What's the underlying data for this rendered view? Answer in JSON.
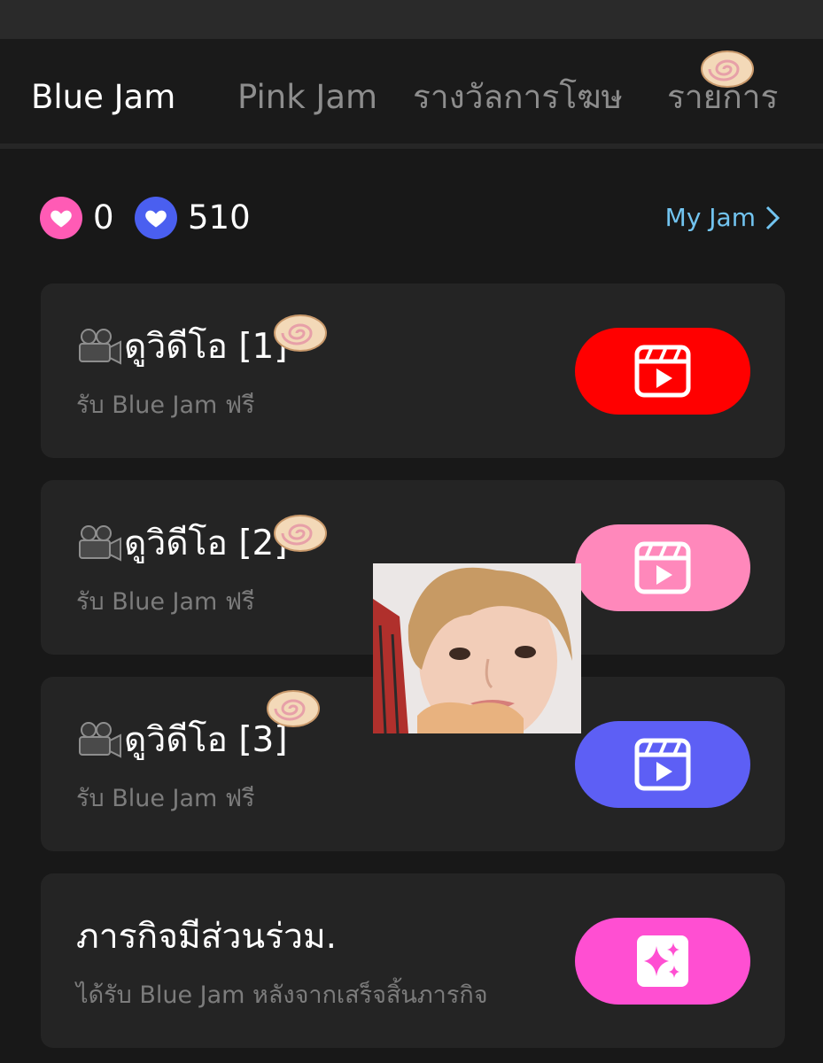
{
  "tabs": [
    {
      "label": "Blue Jam",
      "active": true
    },
    {
      "label": "Pink Jam",
      "active": false
    },
    {
      "label": "รางวัลการโฆษ",
      "active": false
    },
    {
      "label": "รายการ",
      "active": false
    }
  ],
  "balances": {
    "pink_count": "0",
    "blue_count": "510",
    "pink_color": "#ff5bb5",
    "blue_color": "#4a5ff0"
  },
  "my_jam_link": "My Jam",
  "cards": [
    {
      "title": "ดูวิดีโอ [1]",
      "subtitle": "รับ Blue Jam ฟรี",
      "button_color": "#ff0000",
      "icon": "video-clapper-icon"
    },
    {
      "title": "ดูวิดีโอ [2]",
      "subtitle": "รับ Blue Jam ฟรี",
      "button_color": "#ff88bb",
      "icon": "video-clapper-icon"
    },
    {
      "title": "ดูวิดีโอ [3]",
      "subtitle": "รับ Blue Jam ฟรี",
      "button_color": "#5d5ff5",
      "icon": "video-clapper-icon"
    },
    {
      "title": "ภารกิจมีส่วนร่วม.",
      "subtitle": "ได้รับ Blue Jam หลังจากเสร็จสิ้นภารกิจ",
      "button_color": "#ff4fd2",
      "icon": "sparkles-icon"
    }
  ],
  "decorations": {
    "sticker": "face-photo-sticker",
    "bun_icon": "cinnamon-bun-icon"
  }
}
